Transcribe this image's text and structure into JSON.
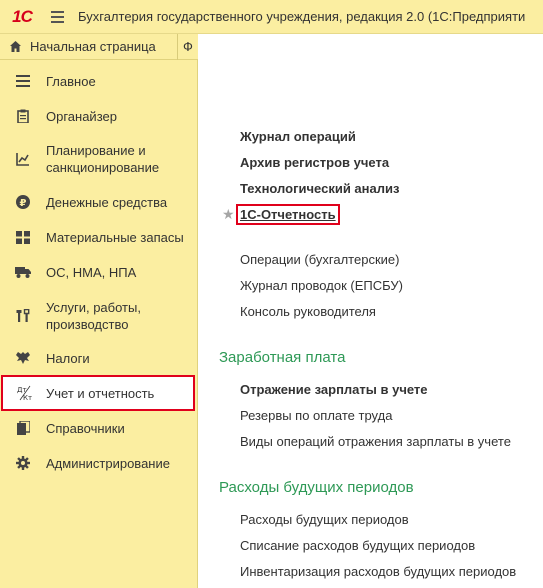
{
  "window": {
    "logo": "1С",
    "title": "Бухгалтерия государственного учреждения, редакция 2.0  (1С:Предприяти"
  },
  "tabs": {
    "home_label": "Начальная страница",
    "second_label": "Ф"
  },
  "sidebar": {
    "items": [
      {
        "label": "Главное",
        "icon": "menu-lines-icon"
      },
      {
        "label": "Органайзер",
        "icon": "clipboard-icon"
      },
      {
        "label": "Планирование и санкционирование",
        "icon": "planning-chart-icon"
      },
      {
        "label": "Денежные средства",
        "icon": "ruble-coin-icon"
      },
      {
        "label": "Материальные запасы",
        "icon": "grid-icon"
      },
      {
        "label": "ОС, НМА, НПА",
        "icon": "truck-icon"
      },
      {
        "label": "Услуги, работы, производство",
        "icon": "tools-icon"
      },
      {
        "label": "Налоги",
        "icon": "emblem-icon"
      },
      {
        "label": "Учет и отчетность",
        "icon": "debit-credit-icon",
        "active": true
      },
      {
        "label": "Справочники",
        "icon": "books-icon"
      },
      {
        "label": "Администрирование",
        "icon": "gear-icon"
      }
    ]
  },
  "main": {
    "group1": {
      "bold_links": [
        "Журнал операций",
        "Архив регистров учета",
        "Технологический анализ",
        "1С-Отчетность"
      ],
      "links": [
        "Операции (бухгалтерские)",
        "Журнал проводок (ЕПСБУ)",
        "Консоль руководителя"
      ]
    },
    "salary": {
      "title": "Заработная плата",
      "bold_links": [
        "Отражение зарплаты в учете"
      ],
      "links": [
        "Резервы по оплате труда",
        "Виды операций отражения зарплаты в учете"
      ]
    },
    "deferred": {
      "title": "Расходы будущих периодов",
      "links": [
        "Расходы будущих периодов",
        "Списание расходов будущих периодов",
        "Инвентаризация расходов будущих периодов"
      ]
    }
  },
  "colors": {
    "panel": "#fbeea1",
    "highlight": "#e0001b",
    "section": "#2e9956"
  }
}
